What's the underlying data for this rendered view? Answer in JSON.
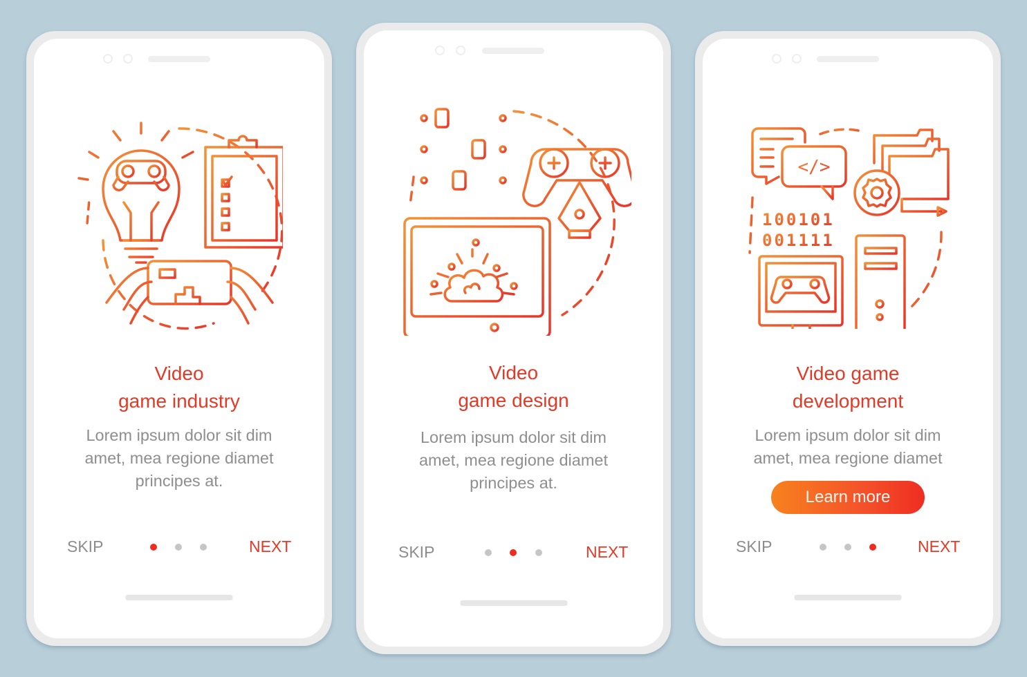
{
  "colors": {
    "background": "#b8ced9",
    "accent": "#e23a26",
    "dot_active": "#ee2c1f",
    "dot_inactive": "#c6c6c6",
    "gradient_start": "#f7821e",
    "gradient_end": "#ee2e21",
    "body_text": "#8e8e8e"
  },
  "screens": [
    {
      "illustration": "video-game-industry-illustration",
      "title_line1": "Video",
      "title_line2": "game industry",
      "desc_line1": "Lorem ipsum dolor sit dim",
      "desc_line2": "amet, mea regione diamet",
      "desc_line3": "principes at.",
      "skip_label": "SKIP",
      "next_label": "NEXT",
      "page_index": 1,
      "page_count": 3
    },
    {
      "illustration": "video-game-design-illustration",
      "title_line1": "Video",
      "title_line2": "game design",
      "desc_line1": "Lorem ipsum dolor sit dim",
      "desc_line2": "amet, mea regione diamet",
      "desc_line3": "principes at.",
      "skip_label": "SKIP",
      "next_label": "NEXT",
      "page_index": 2,
      "page_count": 3
    },
    {
      "illustration": "video-game-development-illustration",
      "title_line1": "Video game",
      "title_line2": "development",
      "desc_line1": "Lorem ipsum dolor sit dim",
      "desc_line2": "amet, mea regione diamet",
      "button_label": "Learn more",
      "skip_label": "SKIP",
      "next_label": "NEXT",
      "page_index": 3,
      "page_count": 3
    }
  ],
  "illustration_text": {
    "binary_row1": "100101",
    "binary_row2": "001111",
    "code_tag": "</>"
  }
}
